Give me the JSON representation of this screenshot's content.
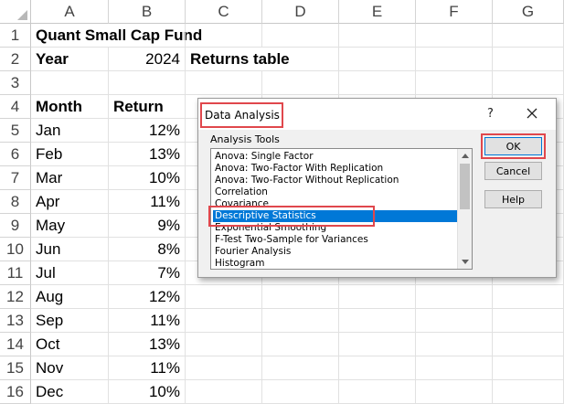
{
  "columns": [
    "A",
    "B",
    "C",
    "D",
    "E",
    "F",
    "G"
  ],
  "rows": [
    "1",
    "2",
    "3",
    "4",
    "5",
    "6",
    "7",
    "8",
    "9",
    "10",
    "11",
    "12",
    "13",
    "14",
    "15",
    "16"
  ],
  "cells": {
    "a1": "Quant Small Cap Fund",
    "a2": "Year",
    "b2": "2024",
    "c2": "Returns table",
    "a4": "Month",
    "b4": "Return",
    "months": [
      "Jan",
      "Feb",
      "Mar",
      "Apr",
      "May",
      "Jun",
      "Jul",
      "Aug",
      "Sep",
      "Oct",
      "Nov",
      "Dec"
    ],
    "returns": [
      "12%",
      "13%",
      "10%",
      "11%",
      "9%",
      "8%",
      "7%",
      "12%",
      "11%",
      "13%",
      "11%",
      "10%"
    ]
  },
  "dialog": {
    "title": "Data Analysis",
    "help_symbol": "?",
    "group_label": "Analysis Tools",
    "tools": [
      "Anova: Single Factor",
      "Anova: Two-Factor With Replication",
      "Anova: Two-Factor Without Replication",
      "Correlation",
      "Covariance",
      "Descriptive Statistics",
      "Exponential Smoothing",
      "F-Test Two-Sample for Variances",
      "Fourier Analysis",
      "Histogram"
    ],
    "selected_index": 5,
    "ok_label": "OK",
    "cancel_label": "Cancel",
    "help_label": "Help",
    "highlight_color": "#e0474c",
    "selection_color": "#0078d7"
  }
}
